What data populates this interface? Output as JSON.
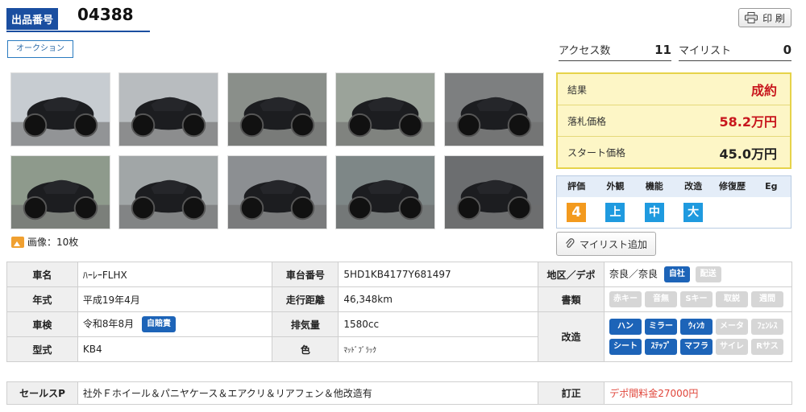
{
  "lot": {
    "label": "出品番号",
    "number": "04388"
  },
  "auction_badge": "オークション",
  "print_label": "印 刷",
  "stats": {
    "access_label": "アクセス数",
    "access_value": "11",
    "mylist_label": "マイリスト",
    "mylist_value": "0"
  },
  "result": {
    "result_label": "結果",
    "result_value": "成約",
    "winning_label": "落札価格",
    "winning_value": "58.2万円",
    "start_label": "スタート価格",
    "start_value": "45.0万円"
  },
  "evaluation": {
    "headers": [
      "評価",
      "外観",
      "機能",
      "改造",
      "修復歴",
      "Eg"
    ],
    "values": [
      "4",
      "上",
      "中",
      "大",
      "",
      ""
    ]
  },
  "image_count": "画像：10枚",
  "mylist_add_label": "マイリスト追加",
  "spec": {
    "name_label": "車名",
    "name_value": "ﾊｰﾚｰFLHX",
    "frame_label": "車台番号",
    "frame_value": "5HD1KB4177Y681497",
    "region_label": "地区／デポ",
    "region_value": "奈良／奈良",
    "region_tag_on": "自社",
    "region_tag_off": "配送",
    "year_label": "年式",
    "year_value": "平成19年4月",
    "mileage_label": "走行距離",
    "mileage_value": "46,348km",
    "docs_label": "書類",
    "docs_tags": [
      "赤キー",
      "音無",
      "Sキー",
      "取説",
      "週間"
    ],
    "inspection_label": "車検",
    "inspection_value": "令和8年8月",
    "inspection_tag": "自賠責",
    "displacement_label": "排気量",
    "displacement_value": "1580cc",
    "mods_label": "改造",
    "mods_tags_row1": [
      {
        "text": "ハン",
        "on": true
      },
      {
        "text": "ミラー",
        "on": true
      },
      {
        "text": "ｳｨﾝｶ",
        "on": true
      },
      {
        "text": "メータ",
        "on": false
      },
      {
        "text": "ﾌｪﾝﾚｽ",
        "on": false
      }
    ],
    "mods_tags_row2": [
      {
        "text": "シート",
        "on": true
      },
      {
        "text": "ｽﾃｯﾌﾟ",
        "on": true
      },
      {
        "text": "マフラ",
        "on": true
      },
      {
        "text": "サイレ",
        "on": false
      },
      {
        "text": "Rサス",
        "on": false
      }
    ],
    "model_label": "型式",
    "model_value": "KB4",
    "color_label": "色",
    "color_value": "ﾏｯﾄﾞﾌﾞﾗｯｸ"
  },
  "sales": {
    "label": "セールスP",
    "value": "社外Ｆホイール＆パニヤケース＆エアクリ＆リアフェン＆他改造有",
    "correction_label": "訂正",
    "correction_value": "デポ間料金27000円"
  },
  "colors": {
    "brand": "#1a4ea0",
    "accent_red": "#c8161d",
    "tag_blue": "#1d64b8"
  }
}
